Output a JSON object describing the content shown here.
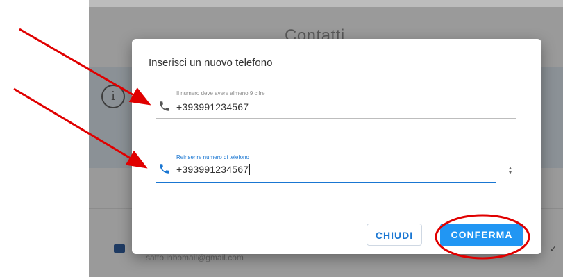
{
  "background": {
    "title": "Contatti",
    "info_symbol": "i",
    "email": "satto.inbomail@gmail.com",
    "chevron": "✓"
  },
  "dialog": {
    "title": "Inserisci un nuovo telefono",
    "fields": [
      {
        "label": "Il numero deve avere almeno 9 cifre",
        "value": "+393991234567",
        "icon": "phone-icon"
      },
      {
        "label": "Reinserire numero di telefono",
        "value": "+393991234567",
        "icon": "phone-icon",
        "spinner_up": "▴",
        "spinner_down": "▾"
      }
    ],
    "buttons": {
      "close": "CHIUDI",
      "confirm": "CONFERMA"
    }
  },
  "colors": {
    "primary": "#1976d2",
    "confirm_bg": "#2196f3",
    "annotation": "#e00000"
  }
}
